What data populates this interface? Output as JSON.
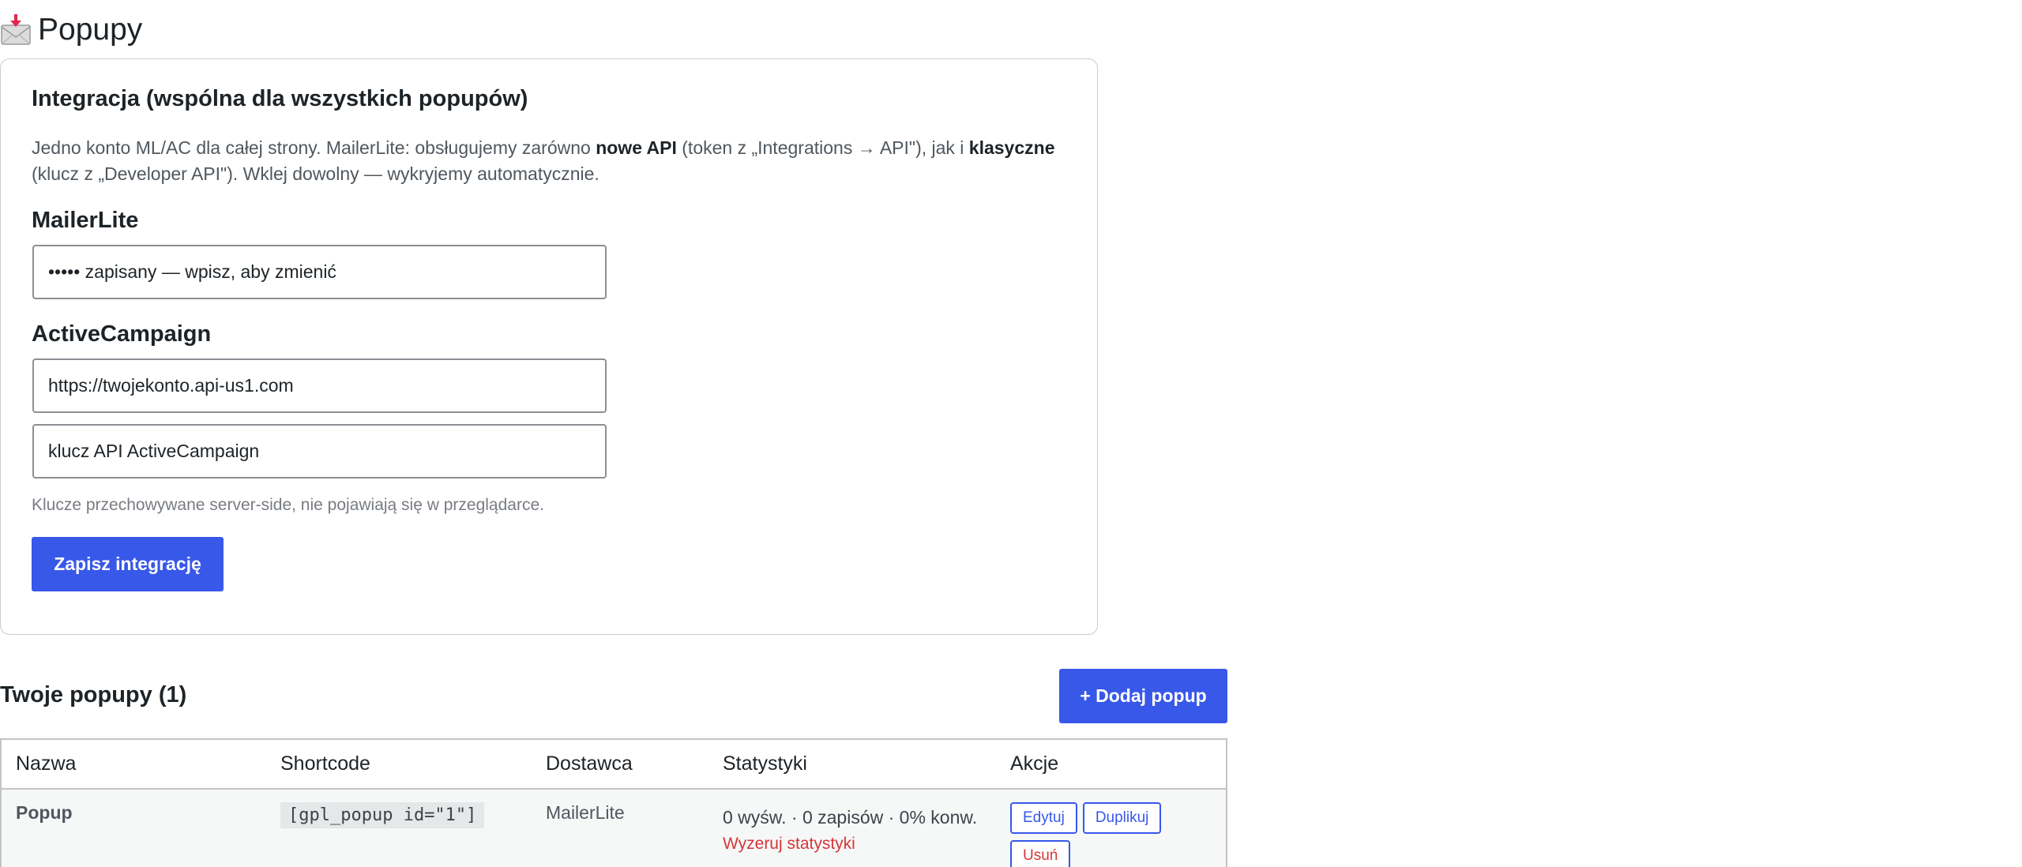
{
  "page": {
    "title": "Popupy",
    "title_icon": "incoming-envelope-icon"
  },
  "integration": {
    "heading": "Integracja (wspólna dla wszystkich popupów)",
    "desc_part1": "Jedno konto ML/AC dla całej strony. MailerLite: obsługujemy zarówno ",
    "desc_bold1": "nowe API",
    "desc_part2": " (token z „Integrations → API\"), jak i ",
    "desc_bold2": "klasyczne",
    "desc_part3": " (klucz z „Developer API\"). Wklej dowolny — wykryjemy automatycznie.",
    "mailerlite_label": "MailerLite",
    "mailerlite_placeholder": "••••• zapisany — wpisz, aby zmienić",
    "activecampaign_label": "ActiveCampaign",
    "ac_url_placeholder": "https://twojekonto.api-us1.com",
    "ac_key_placeholder": "klucz API ActiveCampaign",
    "hint": "Klucze przechowywane server-side, nie pojawiają się w przeglądarce.",
    "save_label": "Zapisz integrację"
  },
  "popups": {
    "heading": "Twoje popupy (1)",
    "add_label": "+ Dodaj popup",
    "columns": {
      "name": "Nazwa",
      "shortcode": "Shortcode",
      "provider": "Dostawca",
      "stats": "Statystyki",
      "actions": "Akcje"
    },
    "rows": [
      {
        "name": "Popup",
        "shortcode": "[gpl_popup id=\"1\"]",
        "provider": "MailerLite",
        "stats": "0 wyśw. · 0 zapisów · 0% konw.",
        "reset_label": "Wyzeruj statystyki",
        "edit_label": "Edytuj",
        "duplicate_label": "Duplikuj",
        "delete_label": "Usuń"
      }
    ]
  },
  "colors": {
    "primary": "#3858e9",
    "danger": "#d63638",
    "border": "#c3c4c7"
  }
}
